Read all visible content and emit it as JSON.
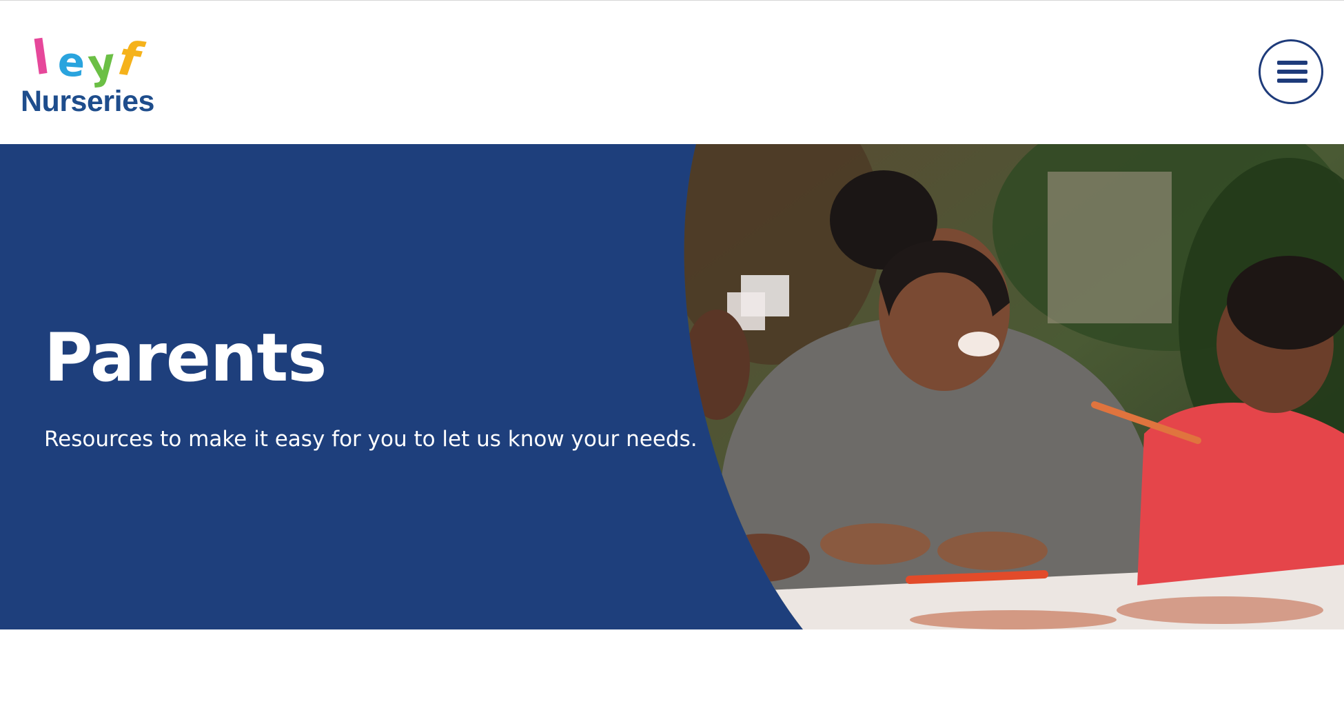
{
  "header": {
    "logo": {
      "letters": [
        "l",
        "e",
        "y",
        "f"
      ],
      "letter_colors": [
        "#e6479a",
        "#2aa4de",
        "#6bbf45",
        "#f5b21b"
      ],
      "subtitle": "Nurseries",
      "subtitle_color": "#1e4d8c"
    },
    "menu_button": {
      "icon": "hamburger-menu-icon",
      "color": "#1e3b7a"
    }
  },
  "hero": {
    "title": "Parents",
    "subtitle": "Resources to make it easy for you to let us know your needs.",
    "panel_color": "#1e3f7c",
    "photo": "nursery-worker-painting-with-children"
  }
}
